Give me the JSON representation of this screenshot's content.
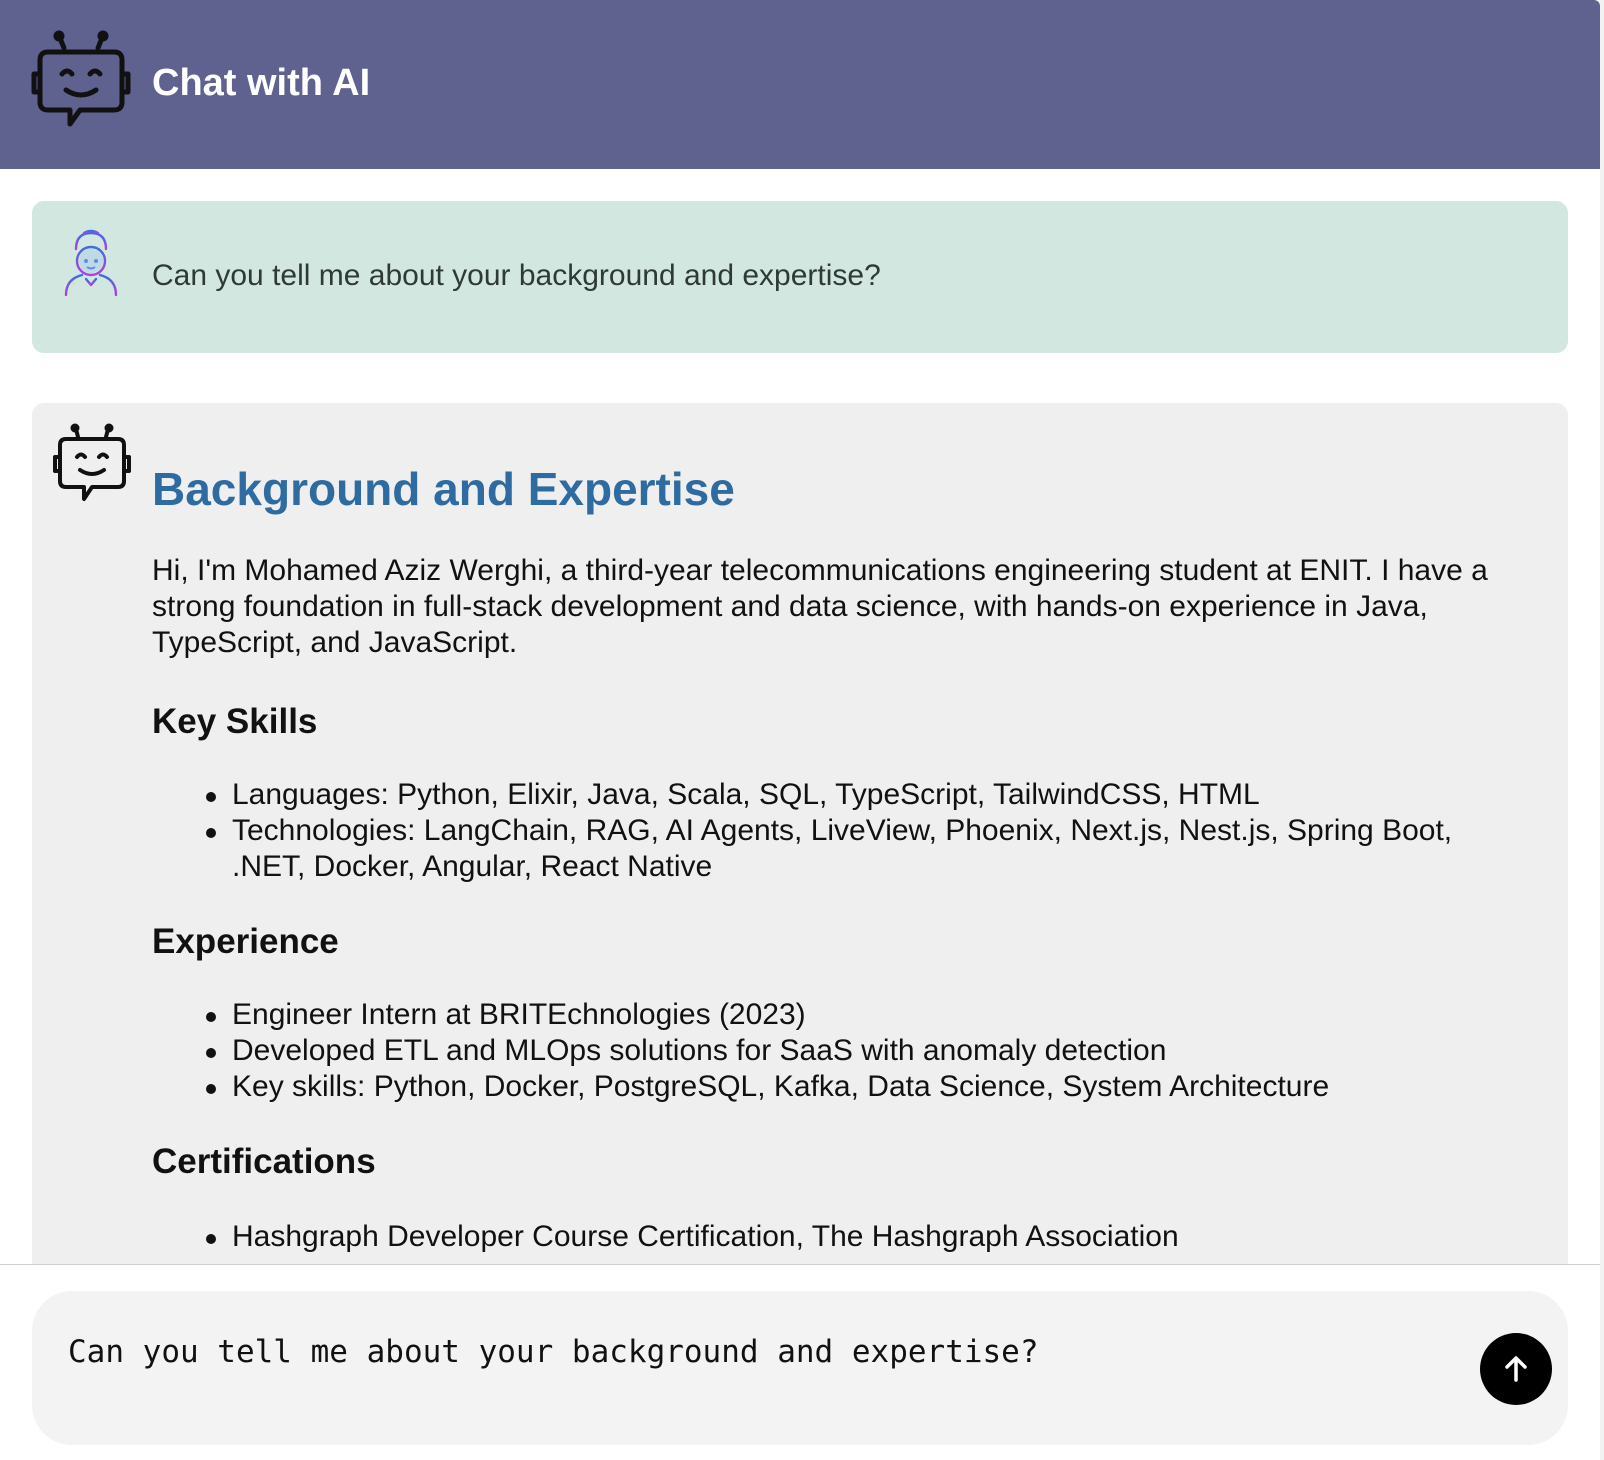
{
  "header": {
    "title": "Chat with AI",
    "logo_icon": "robot-icon"
  },
  "messages": {
    "user": {
      "avatar_icon": "user-avatar-icon",
      "text": "Can you tell me about your background and expertise?"
    },
    "ai": {
      "avatar_icon": "robot-icon",
      "heading": "Background and Expertise",
      "intro": "Hi, I'm Mohamed Aziz Werghi, a third-year telecommunications engineering student at ENIT. I have a strong foundation in full-stack development and data science, with hands-on experience in Java, TypeScript, and JavaScript.",
      "sections": {
        "skills": {
          "title": "Key Skills",
          "items": [
            "Languages: Python, Elixir, Java, Scala, SQL, TypeScript, TailwindCSS, HTML",
            "Technologies: LangChain, RAG, AI Agents, LiveView, Phoenix, Next.js, Nest.js, Spring Boot, .NET, Docker, Angular, React Native"
          ]
        },
        "experience": {
          "title": "Experience",
          "items": [
            "Engineer Intern at BRITEchnologies (2023)",
            "Developed ETL and MLOps solutions for SaaS with anomaly detection",
            "Key skills: Python, Docker, PostgreSQL, Kafka, Data Science, System Architecture"
          ]
        },
        "certifications": {
          "title": "Certifications",
          "items": [
            "Hashgraph Developer Course Certification, The Hashgraph Association"
          ]
        }
      }
    }
  },
  "input": {
    "value": "Can you tell me about your background and expertise?",
    "send_icon": "arrow-up-icon"
  },
  "colors": {
    "header_bg": "#5f618f",
    "user_bubble_bg": "#d2e7df",
    "ai_bubble_bg": "#efefef",
    "heading_color": "#2e6ba1",
    "send_button_bg": "#000000"
  }
}
